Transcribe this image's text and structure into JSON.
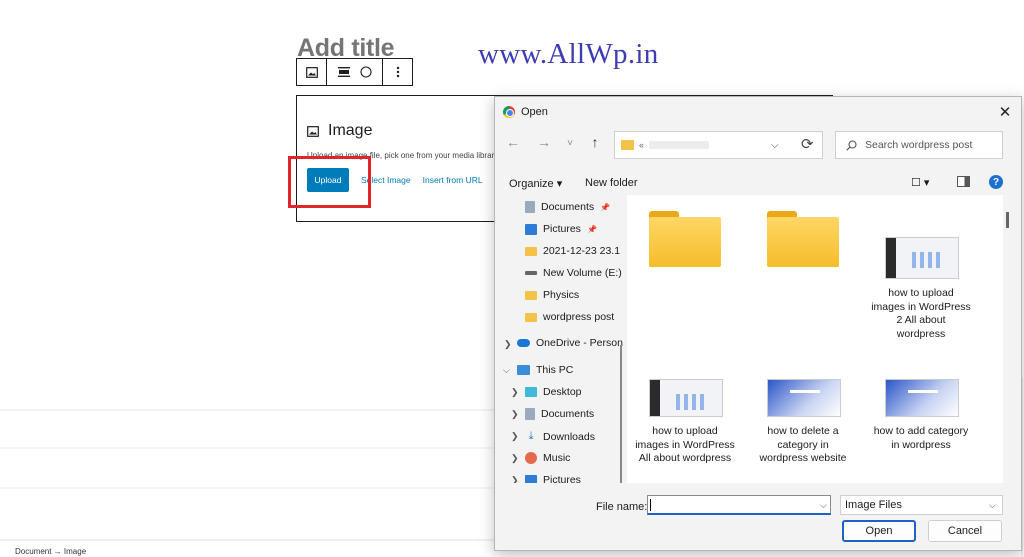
{
  "editor": {
    "title": "Add title",
    "watermark": "www.AllWp.in",
    "toolbar_icons": [
      "image-icon",
      "align-icon",
      "circle-icon",
      "more-options-icon"
    ],
    "block": {
      "title": "Image",
      "instruction": "Upload an image file, pick one from your media library, or add one with a URL.",
      "upload_label": "Upload",
      "select_image_label": "Select Image",
      "insert_url_label": "Insert from URL"
    },
    "breadcrumb": "Document → Image",
    "colors": {
      "accent": "#007cba",
      "highlight": "#e2242b",
      "watermark": "#3d3cb5"
    }
  },
  "dialog": {
    "title": "Open",
    "close_glyph": "✕",
    "nav": {
      "back": "←",
      "forward": "→",
      "recent": "˅",
      "up": "↑",
      "refresh": "⟳"
    },
    "address_prefix": "«",
    "search_placeholder": "Search wordpress post",
    "commands": {
      "organize": "Organize ▾",
      "new_folder": "New folder",
      "view": "☐ ▾",
      "help": "?"
    },
    "nav_items": [
      {
        "label": "Documents",
        "icon": "documents-icon",
        "pinned": true
      },
      {
        "label": "Pictures",
        "icon": "pictures-icon",
        "pinned": true
      },
      {
        "label": "2021-12-23 23.1",
        "icon": "folder-icon"
      },
      {
        "label": "New Volume (E:)",
        "icon": "drive-icon"
      },
      {
        "label": "Physics",
        "icon": "folder-icon"
      },
      {
        "label": "wordpress post",
        "icon": "folder-icon"
      },
      {
        "label": "OneDrive - Person",
        "icon": "onedrive-icon"
      },
      {
        "label": "This PC",
        "icon": "this-pc-icon"
      },
      {
        "label": "Desktop",
        "icon": "desktop-icon"
      },
      {
        "label": "Documents",
        "icon": "documents-icon"
      },
      {
        "label": "Downloads",
        "icon": "downloads-icon"
      },
      {
        "label": "Music",
        "icon": "music-icon"
      },
      {
        "label": "Pictures",
        "icon": "pictures-icon"
      }
    ],
    "files": [
      {
        "type": "folder",
        "label": ""
      },
      {
        "type": "folder",
        "label": ""
      },
      {
        "type": "image",
        "label": "how to upload images in WordPress 2 All about wordpress"
      },
      {
        "type": "image",
        "label": "how to upload images in WordPress All about wordpress"
      },
      {
        "type": "image",
        "label": "how to delete a category in wordpress website"
      },
      {
        "type": "image",
        "label": "how to add category in wordpress"
      }
    ],
    "file_name_label": "File name:",
    "file_name_value": "",
    "file_type": "Image Files",
    "open_label": "Open",
    "cancel_label": "Cancel"
  }
}
